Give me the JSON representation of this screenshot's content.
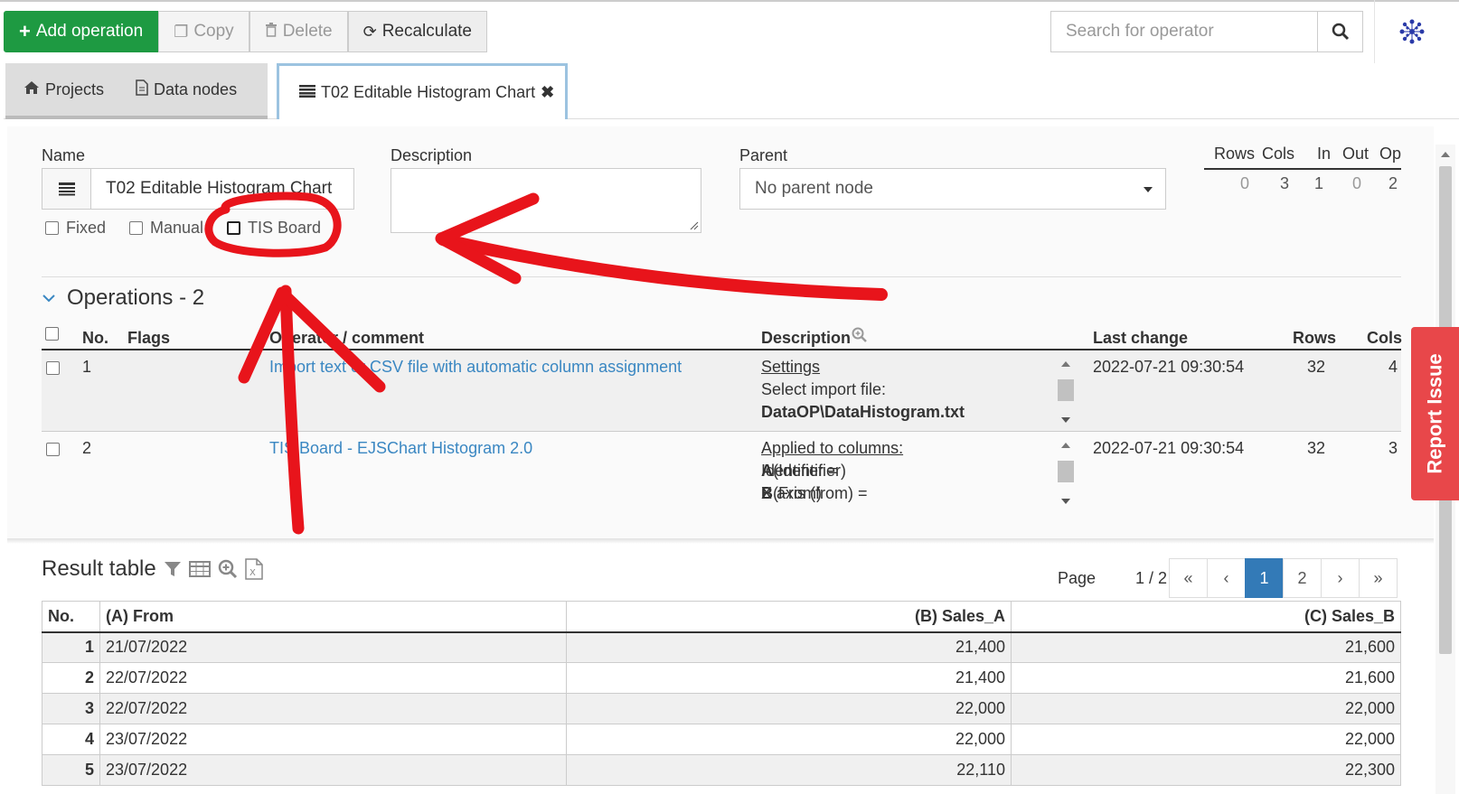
{
  "toolbar": {
    "add_label": "Add operation",
    "copy_label": "Copy",
    "delete_label": "Delete",
    "recalc_label": "Recalculate"
  },
  "search": {
    "placeholder": "Search for operator"
  },
  "tabs": [
    {
      "label": "Projects"
    },
    {
      "label": "Data nodes"
    },
    {
      "label": "T02 Editable Histogram Chart"
    }
  ],
  "form": {
    "name_label": "Name",
    "name_value": "T02 Editable Histogram Chart",
    "description_label": "Description",
    "parent_label": "Parent",
    "parent_value": "No parent node",
    "fixed_label": "Fixed",
    "manual_label": "Manual",
    "tis_board_label": "TIS Board"
  },
  "stats": {
    "headers": [
      "Rows",
      "Cols",
      "In",
      "Out",
      "Op"
    ],
    "values": [
      "0",
      "3",
      "1",
      "0",
      "2"
    ]
  },
  "operations": {
    "title": "Operations - 2",
    "headers": {
      "no": "No.",
      "flags": "Flags",
      "operator": "Operator / comment",
      "description": "Description",
      "last_change": "Last change",
      "rows": "Rows",
      "cols": "Cols"
    },
    "rows": [
      {
        "no": "1",
        "operator": "Import text or CSV file with automatic column assignment",
        "desc_head": "Settings",
        "desc_line1": "Select import file:",
        "desc_line2": "DataOP\\DataHistogram.txt",
        "last_change": "2022-07-21 09:30:54",
        "rows": "32",
        "cols": "4"
      },
      {
        "no": "2",
        "operator": "TIS Board - EJSChart Histogram 2.0",
        "desc_head": "Applied to columns:",
        "desc_line1_pre": "Identifier = ",
        "desc_line1_b": "A",
        "desc_line1_post": " (Identifier)",
        "desc_line2_pre": "X axis (from) = ",
        "desc_line2_b": "B",
        "desc_line2_post": " (From)",
        "last_change": "2022-07-21 09:30:54",
        "rows": "32",
        "cols": "3"
      }
    ]
  },
  "result": {
    "title": "Result table",
    "page_label": "Page",
    "page_value": "1 / 2",
    "pager": [
      "«",
      "‹",
      "1",
      "2",
      "›",
      "»"
    ],
    "headers": [
      "No.",
      "(A) From",
      "(B) Sales_A",
      "(C) Sales_B"
    ],
    "rows": [
      [
        "1",
        "21/07/2022",
        "21,400",
        "21,600"
      ],
      [
        "2",
        "22/07/2022",
        "21,400",
        "21,600"
      ],
      [
        "3",
        "22/07/2022",
        "22,000",
        "22,000"
      ],
      [
        "4",
        "23/07/2022",
        "22,000",
        "22,000"
      ],
      [
        "5",
        "23/07/2022",
        "22,110",
        "22,300"
      ]
    ]
  },
  "report_issue": "Report Issue",
  "colors": {
    "accent": "#1e9a42",
    "link": "#3a87c2",
    "annotation": "#e8141b",
    "report": "#e8474a"
  }
}
